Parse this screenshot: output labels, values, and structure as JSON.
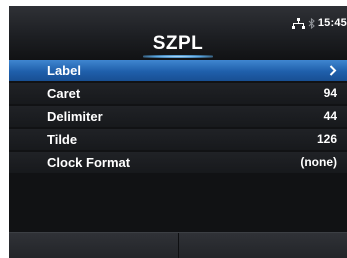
{
  "header": {
    "title": "SZPL",
    "time": "15:45",
    "network_icon": "network-icon",
    "bluetooth_icon": "bluetooth-icon"
  },
  "menu": {
    "items": [
      {
        "label": "Label",
        "value": "",
        "selected": true,
        "icon": "chevron-right-icon"
      },
      {
        "label": "Caret",
        "value": "94"
      },
      {
        "label": "Delimiter",
        "value": "44"
      },
      {
        "label": "Tilde",
        "value": "126"
      },
      {
        "label": "Clock Format",
        "value": "(none)"
      }
    ]
  },
  "colors": {
    "selected": "#2a6fbf",
    "background": "#111214",
    "text": "#ffffff"
  }
}
